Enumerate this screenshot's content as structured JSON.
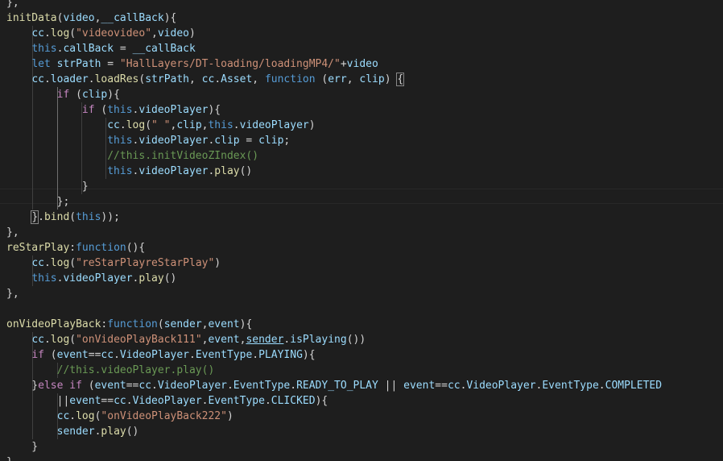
{
  "editor": {
    "language": "javascript",
    "colors": {
      "background": "#1e1e1e",
      "keyword": "#569cd6",
      "control": "#c586c0",
      "function": "#dcdcaa",
      "string": "#ce9178",
      "variable": "#9cdcfe",
      "comment": "#6a9955",
      "type": "#4ec9b0",
      "plain": "#d4d4d4"
    },
    "lines": [
      [
        [
          "p",
          "},"
        ]
      ],
      [
        [
          "f",
          "initData"
        ],
        [
          "p",
          "("
        ],
        [
          "v",
          "video"
        ],
        [
          "p",
          ","
        ],
        [
          "v",
          "__callBack"
        ],
        [
          "p",
          "){"
        ]
      ],
      [
        [
          "p",
          "    "
        ],
        [
          "v",
          "cc"
        ],
        [
          "p",
          "."
        ],
        [
          "f",
          "log"
        ],
        [
          "p",
          "("
        ],
        [
          "s",
          "\"videovideo\""
        ],
        [
          "p",
          ","
        ],
        [
          "v",
          "video"
        ],
        [
          "p",
          ")"
        ]
      ],
      [
        [
          "p",
          "    "
        ],
        [
          "k",
          "this"
        ],
        [
          "p",
          "."
        ],
        [
          "v",
          "callBack"
        ],
        [
          "p",
          " = "
        ],
        [
          "v",
          "__callBack"
        ]
      ],
      [
        [
          "p",
          "    "
        ],
        [
          "k",
          "let"
        ],
        [
          "p",
          " "
        ],
        [
          "v",
          "strPath"
        ],
        [
          "p",
          " = "
        ],
        [
          "s",
          "\"HallLayers/DT-loading/loadingMP4/\""
        ],
        [
          "p",
          "+"
        ],
        [
          "v",
          "video"
        ]
      ],
      [
        [
          "p",
          "    "
        ],
        [
          "v",
          "cc"
        ],
        [
          "p",
          "."
        ],
        [
          "v",
          "loader"
        ],
        [
          "p",
          "."
        ],
        [
          "f",
          "loadRes"
        ],
        [
          "p",
          "("
        ],
        [
          "v",
          "strPath"
        ],
        [
          "p",
          ", "
        ],
        [
          "v",
          "cc"
        ],
        [
          "p",
          "."
        ],
        [
          "v",
          "Asset"
        ],
        [
          "p",
          ", "
        ],
        [
          "k",
          "function"
        ],
        [
          "p",
          " ("
        ],
        [
          "v",
          "err"
        ],
        [
          "p",
          ", "
        ],
        [
          "v",
          "clip"
        ],
        [
          "p",
          ") "
        ],
        [
          "b",
          "{"
        ]
      ],
      [
        [
          "p",
          "        "
        ],
        [
          "c",
          "if"
        ],
        [
          "p",
          " ("
        ],
        [
          "v",
          "clip"
        ],
        [
          "p",
          "){"
        ]
      ],
      [
        [
          "p",
          "            "
        ],
        [
          "c",
          "if"
        ],
        [
          "p",
          " ("
        ],
        [
          "k",
          "this"
        ],
        [
          "p",
          "."
        ],
        [
          "v",
          "videoPlayer"
        ],
        [
          "p",
          "){"
        ]
      ],
      [
        [
          "p",
          "                "
        ],
        [
          "v",
          "cc"
        ],
        [
          "p",
          "."
        ],
        [
          "f",
          "log"
        ],
        [
          "p",
          "("
        ],
        [
          "s",
          "\" \""
        ],
        [
          "p",
          ","
        ],
        [
          "v",
          "clip"
        ],
        [
          "p",
          ","
        ],
        [
          "k",
          "this"
        ],
        [
          "p",
          "."
        ],
        [
          "v",
          "videoPlayer"
        ],
        [
          "p",
          ")"
        ]
      ],
      [
        [
          "p",
          "                "
        ],
        [
          "k",
          "this"
        ],
        [
          "p",
          "."
        ],
        [
          "v",
          "videoPlayer"
        ],
        [
          "p",
          "."
        ],
        [
          "v",
          "clip"
        ],
        [
          "p",
          " = "
        ],
        [
          "v",
          "clip"
        ],
        [
          "p",
          ";"
        ]
      ],
      [
        [
          "p",
          "                "
        ],
        [
          "m",
          "//this.initVideoZIndex()"
        ]
      ],
      [
        [
          "p",
          "                "
        ],
        [
          "k",
          "this"
        ],
        [
          "p",
          "."
        ],
        [
          "v",
          "videoPlayer"
        ],
        [
          "p",
          "."
        ],
        [
          "f",
          "play"
        ],
        [
          "p",
          "()"
        ]
      ],
      [
        [
          "p",
          "            }"
        ]
      ],
      [
        [
          "p",
          "        };"
        ]
      ],
      [
        [
          "p",
          "    "
        ],
        [
          "b",
          "}"
        ],
        [
          "p",
          "."
        ],
        [
          "f",
          "bind"
        ],
        [
          "p",
          "("
        ],
        [
          "k",
          "this"
        ],
        [
          "p",
          "));"
        ]
      ],
      [
        [
          "p",
          "},"
        ]
      ],
      [
        [
          "f",
          "reStarPlay"
        ],
        [
          "p",
          ":"
        ],
        [
          "k",
          "function"
        ],
        [
          "p",
          "(){"
        ]
      ],
      [
        [
          "p",
          "    "
        ],
        [
          "v",
          "cc"
        ],
        [
          "p",
          "."
        ],
        [
          "f",
          "log"
        ],
        [
          "p",
          "("
        ],
        [
          "s",
          "\"reStarPlayreStarPlay\""
        ],
        [
          "p",
          ")"
        ]
      ],
      [
        [
          "p",
          "    "
        ],
        [
          "k",
          "this"
        ],
        [
          "p",
          "."
        ],
        [
          "v",
          "videoPlayer"
        ],
        [
          "p",
          "."
        ],
        [
          "f",
          "play"
        ],
        [
          "p",
          "()"
        ]
      ],
      [
        [
          "p",
          "},"
        ]
      ],
      [],
      [
        [
          "f",
          "onVideoPlayBack"
        ],
        [
          "p",
          ":"
        ],
        [
          "k",
          "function"
        ],
        [
          "p",
          "("
        ],
        [
          "v",
          "sender"
        ],
        [
          "p",
          ","
        ],
        [
          "v",
          "event"
        ],
        [
          "p",
          "){"
        ]
      ],
      [
        [
          "p",
          "    "
        ],
        [
          "v",
          "cc"
        ],
        [
          "p",
          "."
        ],
        [
          "f",
          "log"
        ],
        [
          "p",
          "("
        ],
        [
          "s",
          "\"onVideoPlayBack111\""
        ],
        [
          "p",
          ","
        ],
        [
          "v",
          "event"
        ],
        [
          "p",
          ","
        ],
        [
          "u",
          "sender"
        ],
        [
          "p",
          "."
        ],
        [
          "v",
          "isPlaying"
        ],
        [
          "p",
          "())"
        ]
      ],
      [
        [
          "p",
          "    "
        ],
        [
          "c",
          "if"
        ],
        [
          "p",
          " ("
        ],
        [
          "v",
          "event"
        ],
        [
          "p",
          "=="
        ],
        [
          "v",
          "cc"
        ],
        [
          "p",
          "."
        ],
        [
          "v",
          "VideoPlayer"
        ],
        [
          "p",
          "."
        ],
        [
          "v",
          "EventType"
        ],
        [
          "p",
          "."
        ],
        [
          "v",
          "PLAYING"
        ],
        [
          "p",
          "){"
        ]
      ],
      [
        [
          "p",
          "        "
        ],
        [
          "m",
          "//this.videoPlayer.play()"
        ]
      ],
      [
        [
          "p",
          "    }"
        ],
        [
          "c",
          "else"
        ],
        [
          "p",
          " "
        ],
        [
          "c",
          "if"
        ],
        [
          "p",
          " ("
        ],
        [
          "v",
          "event"
        ],
        [
          "p",
          "=="
        ],
        [
          "v",
          "cc"
        ],
        [
          "p",
          "."
        ],
        [
          "v",
          "VideoPlayer"
        ],
        [
          "p",
          "."
        ],
        [
          "v",
          "EventType"
        ],
        [
          "p",
          "."
        ],
        [
          "v",
          "READY_TO_PLAY"
        ],
        [
          "p",
          " || "
        ],
        [
          "v",
          "event"
        ],
        [
          "p",
          "=="
        ],
        [
          "v",
          "cc"
        ],
        [
          "p",
          "."
        ],
        [
          "v",
          "VideoPlayer"
        ],
        [
          "p",
          "."
        ],
        [
          "v",
          "EventType"
        ],
        [
          "p",
          "."
        ],
        [
          "v",
          "COMPLETED"
        ]
      ],
      [
        [
          "p",
          "        ||"
        ],
        [
          "v",
          "event"
        ],
        [
          "p",
          "=="
        ],
        [
          "v",
          "cc"
        ],
        [
          "p",
          "."
        ],
        [
          "v",
          "VideoPlayer"
        ],
        [
          "p",
          "."
        ],
        [
          "v",
          "EventType"
        ],
        [
          "p",
          "."
        ],
        [
          "v",
          "CLICKED"
        ],
        [
          "p",
          "){"
        ]
      ],
      [
        [
          "p",
          "        "
        ],
        [
          "v",
          "cc"
        ],
        [
          "p",
          "."
        ],
        [
          "f",
          "log"
        ],
        [
          "p",
          "("
        ],
        [
          "s",
          "\"onVideoPlayBack222\""
        ],
        [
          "p",
          ")"
        ]
      ],
      [
        [
          "p",
          "        "
        ],
        [
          "v",
          "sender"
        ],
        [
          "p",
          "."
        ],
        [
          "f",
          "play"
        ],
        [
          "p",
          "()"
        ]
      ],
      [
        [
          "p",
          "    }"
        ]
      ],
      [
        [
          "p",
          "},"
        ]
      ]
    ]
  }
}
